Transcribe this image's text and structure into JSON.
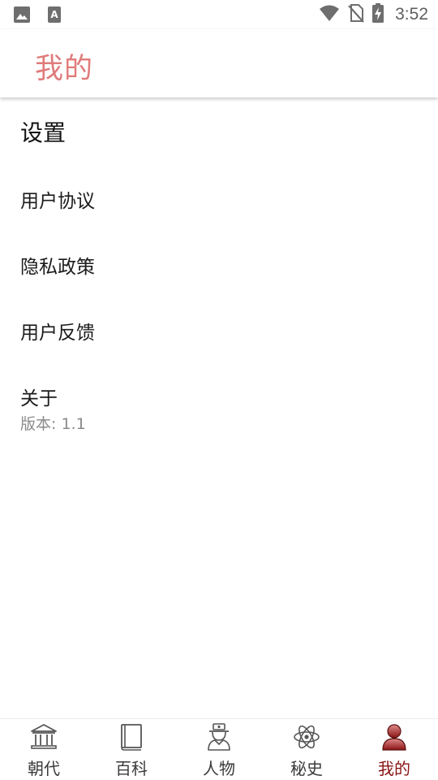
{
  "status_bar": {
    "time": "3:52",
    "left_icons": [
      "image-icon",
      "text-a-icon"
    ],
    "right_icons": [
      "wifi-icon",
      "no-sim-icon",
      "battery-charging-icon"
    ]
  },
  "app_bar": {
    "title": "我的",
    "title_color": "#e07b7b"
  },
  "settings": {
    "header": "设置",
    "items": [
      {
        "label": "用户协议"
      },
      {
        "label": "隐私政策"
      },
      {
        "label": "用户反馈"
      },
      {
        "label": "关于",
        "sublabel": "版本: 1.1"
      }
    ]
  },
  "bottom_nav": {
    "active_color": "#8a1414",
    "items": [
      {
        "label": "朝代",
        "icon": "temple-icon",
        "active": false
      },
      {
        "label": "百科",
        "icon": "book-icon",
        "active": false
      },
      {
        "label": "人物",
        "icon": "person-hat-icon",
        "active": false
      },
      {
        "label": "秘史",
        "icon": "atom-icon",
        "active": false
      },
      {
        "label": "我的",
        "icon": "user-icon",
        "active": true
      }
    ]
  }
}
